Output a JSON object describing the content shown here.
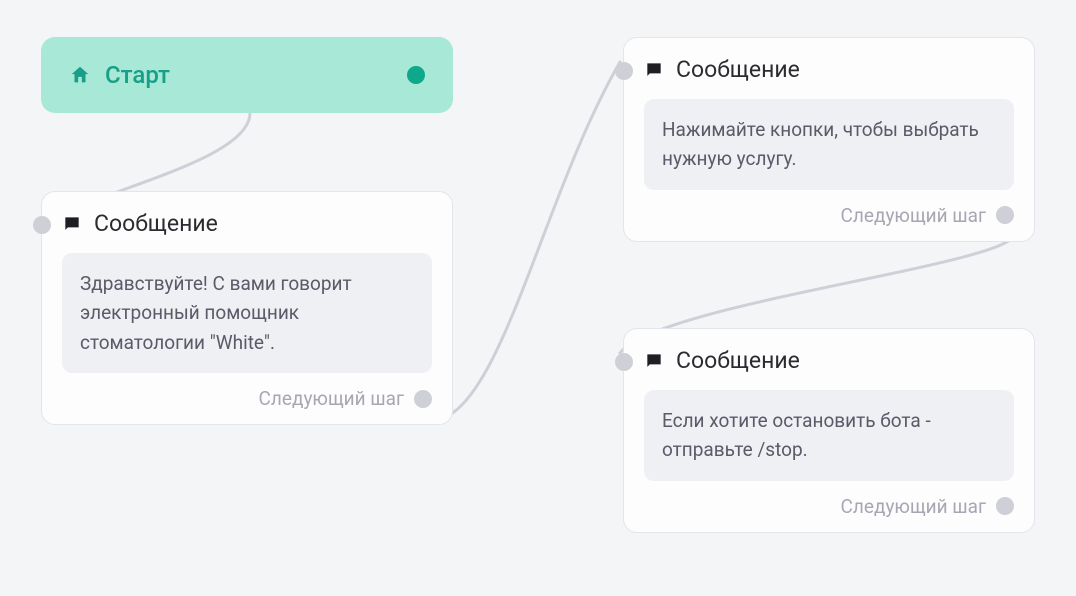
{
  "start": {
    "label": "Старт"
  },
  "nodes": {
    "msg1": {
      "title": "Сообщение",
      "body": "Здравствуйте! С вами говорит электронный помощник стоматологии \"White\".",
      "next": "Следующий шаг"
    },
    "msg2": {
      "title": "Сообщение",
      "body": "Нажимайте кнопки, чтобы выбрать нужную услугу.",
      "next": "Следующий шаг"
    },
    "msg3": {
      "title": "Сообщение",
      "body": "Если хотите остановить бота - отправьте /stop.",
      "next": "Следующий шаг"
    }
  },
  "colors": {
    "start_bg": "#a7e8d6",
    "start_fg": "#179f87",
    "port_idle": "#cfcfd8",
    "port_start": "#0fa88a"
  }
}
